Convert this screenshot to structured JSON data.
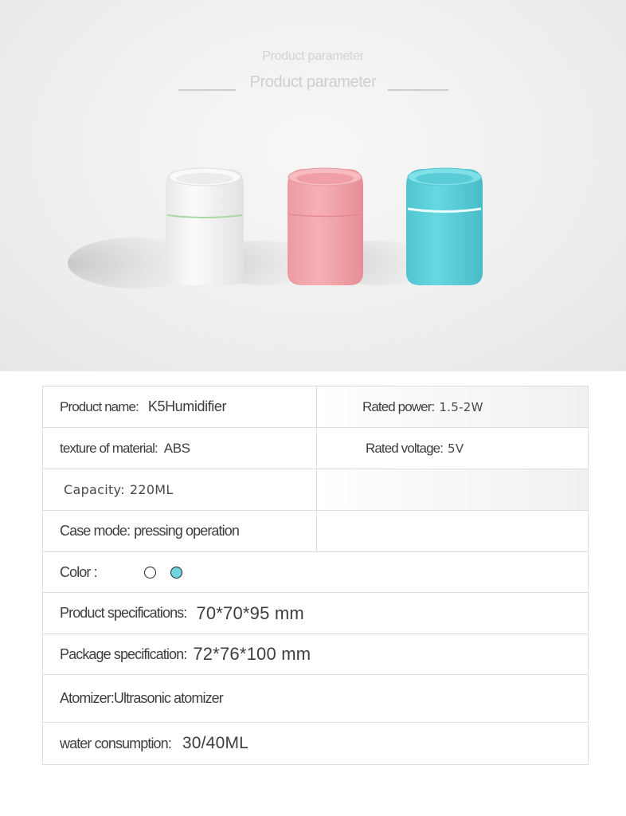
{
  "header": {
    "subtitle": "Product parameter",
    "title": "Product parameter"
  },
  "products": [
    {
      "color": "white",
      "body": "#f4f4f4",
      "ring": "#a9d9a2"
    },
    {
      "color": "pink",
      "body": "#f3a8ad",
      "ring": "#f6c2c4"
    },
    {
      "color": "blue",
      "body": "#5ed3dd",
      "ring": "#eafcff"
    }
  ],
  "specs": {
    "product_name": {
      "label": "Product name:",
      "value": "K5Humidifier"
    },
    "rated_power": {
      "label": "Rated power:",
      "value": "1.5-2W"
    },
    "material": {
      "label": "texture of material:",
      "value": "ABS"
    },
    "rated_voltage": {
      "label": "Rated voltage:",
      "value": "5V"
    },
    "capacity": {
      "label": "Capacity:",
      "value": "220ML"
    },
    "case_mode": {
      "label": "Case mode:",
      "value": "pressing operation"
    },
    "color": {
      "label": "Color :",
      "swatches": [
        {
          "name": "white",
          "fill": "#ffffff"
        },
        {
          "name": "blue",
          "fill": "#6fd6df"
        }
      ]
    },
    "product_specs": {
      "label": "Product specifications:",
      "value": "70*70*95 mm"
    },
    "package_specs": {
      "label": "Package specification:",
      "value": "72*76*100 mm"
    },
    "atomizer": {
      "label": "Atomizer:",
      "value": "Ultrasonic atomizer"
    },
    "water_consumption": {
      "label": "water consumption:",
      "value": "30/40ML"
    }
  }
}
